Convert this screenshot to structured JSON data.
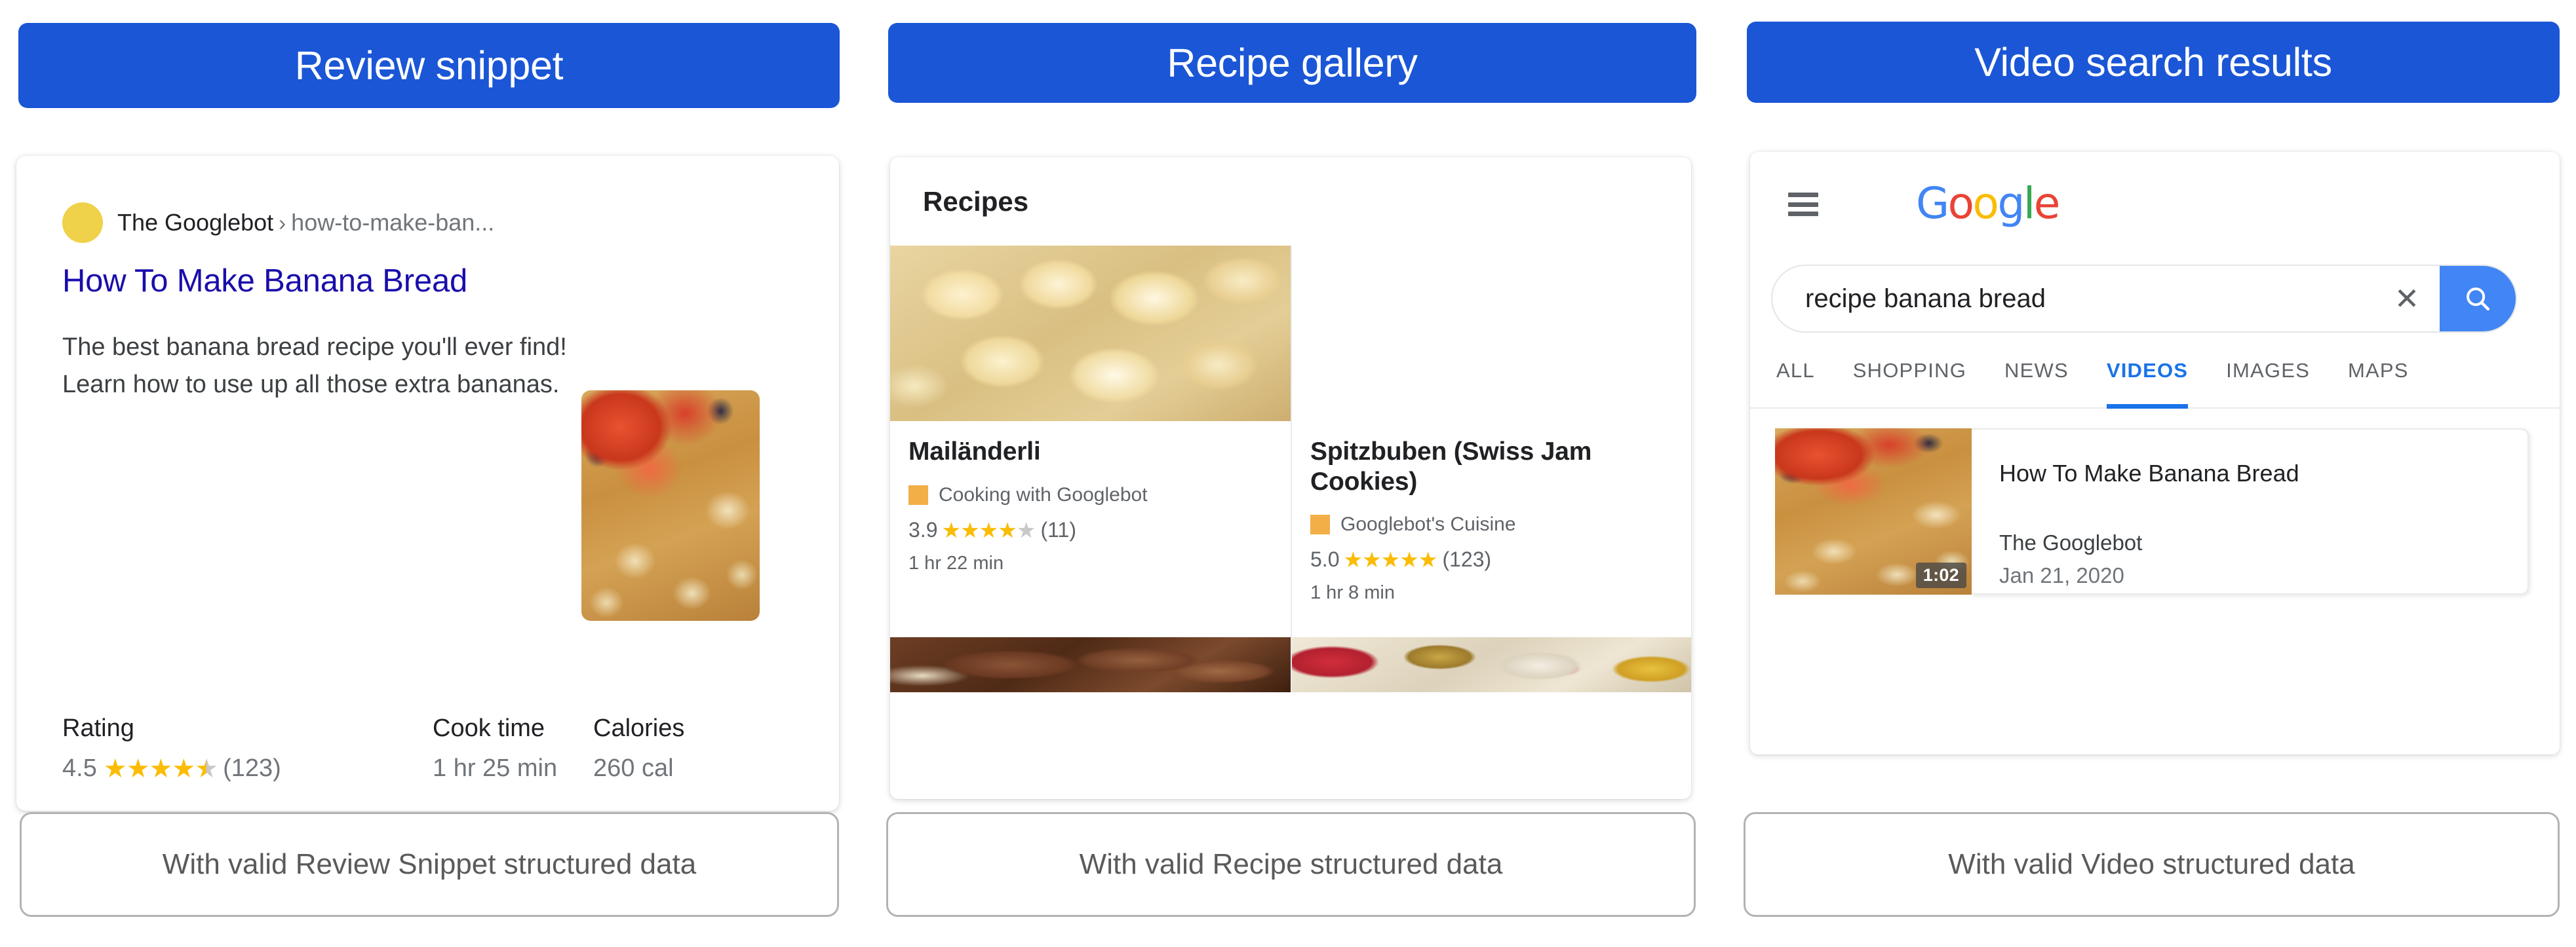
{
  "panels": [
    {
      "header": "Review snippet",
      "caption": "With valid Review Snippet structured data"
    },
    {
      "header": "Recipe gallery",
      "caption": "With valid Recipe structured data"
    },
    {
      "header": "Video search results",
      "caption": "With valid Video structured data"
    }
  ],
  "review_snippet": {
    "breadcrumb_site": "The Googlebot",
    "breadcrumb_sep": "›",
    "breadcrumb_path": "how-to-make-ban...",
    "title": "How To Make Banana Bread",
    "description": "The best banana bread recipe you'll ever find! Learn how to use up all those extra bananas.",
    "thumbnail_alt": "banana-bread-thumbnail",
    "facts": [
      {
        "label": "Rating",
        "value": "4.5",
        "stars": 4.5,
        "count": "(123)"
      },
      {
        "label": "Cook time",
        "value": "1 hr 25 min"
      },
      {
        "label": "Calories",
        "value": "260 cal"
      }
    ]
  },
  "recipe_gallery": {
    "heading": "Recipes",
    "cards": [
      {
        "title": "Mailänderli",
        "source": "Cooking with Googlebot",
        "rating": "3.9",
        "stars": 4,
        "count": "(11)",
        "time": "1 hr 22 min",
        "photo_alt": "butter-cookies-photo",
        "photo_bottom_alt": "chocolate-cookies-photo"
      },
      {
        "title": "Spitzbuben (Swiss Jam Cookies)",
        "source": "Googlebot's Cuisine",
        "rating": "5.0",
        "stars": 5,
        "count": "(123)",
        "time": "1 hr 8 min",
        "photo_alt": "jam-cookies-photo",
        "photo_bottom_alt": "christmas-cookies-photo"
      }
    ]
  },
  "video_search": {
    "logo_letters": [
      {
        "ch": "G",
        "color": "blue"
      },
      {
        "ch": "o",
        "color": "red"
      },
      {
        "ch": "o",
        "color": "yellow"
      },
      {
        "ch": "g",
        "color": "blue"
      },
      {
        "ch": "l",
        "color": "green"
      },
      {
        "ch": "e",
        "color": "red"
      }
    ],
    "search_query": "recipe banana bread",
    "search_placeholder": "Search",
    "clear_label": "✕",
    "tabs": [
      {
        "label": "ALL",
        "active": false
      },
      {
        "label": "SHOPPING",
        "active": false
      },
      {
        "label": "NEWS",
        "active": false
      },
      {
        "label": "VIDEOS",
        "active": true
      },
      {
        "label": "IMAGES",
        "active": false
      },
      {
        "label": "MAPS",
        "active": false
      }
    ],
    "result": {
      "title": "How To Make Banana Bread",
      "channel": "The Googlebot",
      "date": "Jan 21, 2020",
      "duration": "1:02",
      "thumb_alt": "banana-bread-video-thumbnail"
    }
  },
  "colors": {
    "header_blue": "#1a56d6",
    "link_blue": "#1a0dab",
    "tab_active_blue": "#1a73e8",
    "star_gold": "#fbbc04",
    "star_grey": "#c8c8c8",
    "favicon_yellow": "#efd14a",
    "source_favicon_orange": "#f2ae47",
    "caption_border": "#b3b3b3"
  }
}
